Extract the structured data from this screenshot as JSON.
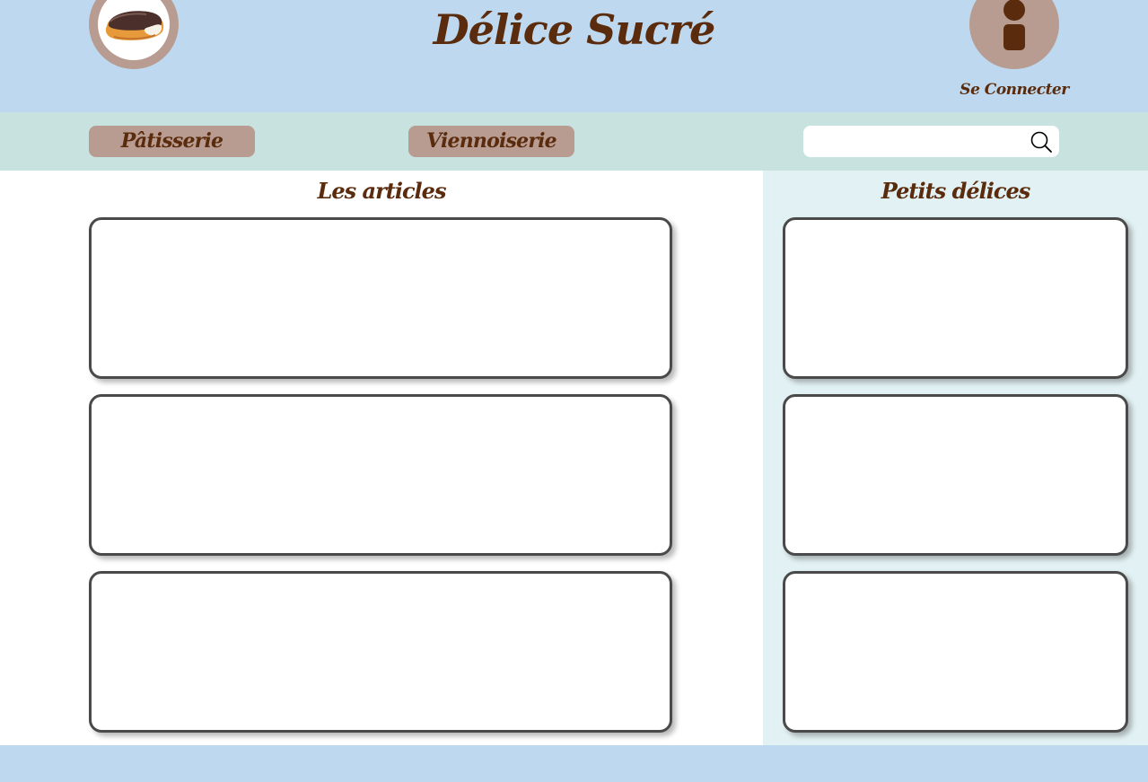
{
  "header": {
    "title": "Délice Sucré",
    "logo_icon": "eclair-logo-icon",
    "account_icon": "user-icon",
    "login_label": "Se Connecter"
  },
  "nav": {
    "items": [
      {
        "label": "Pâtisserie"
      },
      {
        "label": "Viennoiserie"
      }
    ],
    "search": {
      "value": "",
      "placeholder": "",
      "icon": "search-icon"
    }
  },
  "main": {
    "title": "Les articles",
    "cards": [
      {},
      {},
      {}
    ]
  },
  "aside": {
    "title": "Petits délices",
    "cards": [
      {},
      {},
      {}
    ]
  },
  "colors": {
    "header_bg": "#bed9ef",
    "nav_bg": "#c8e3df",
    "aside_bg": "#e2f1f3",
    "accent": "#b89c91",
    "text_brown": "#5a2b0c"
  }
}
